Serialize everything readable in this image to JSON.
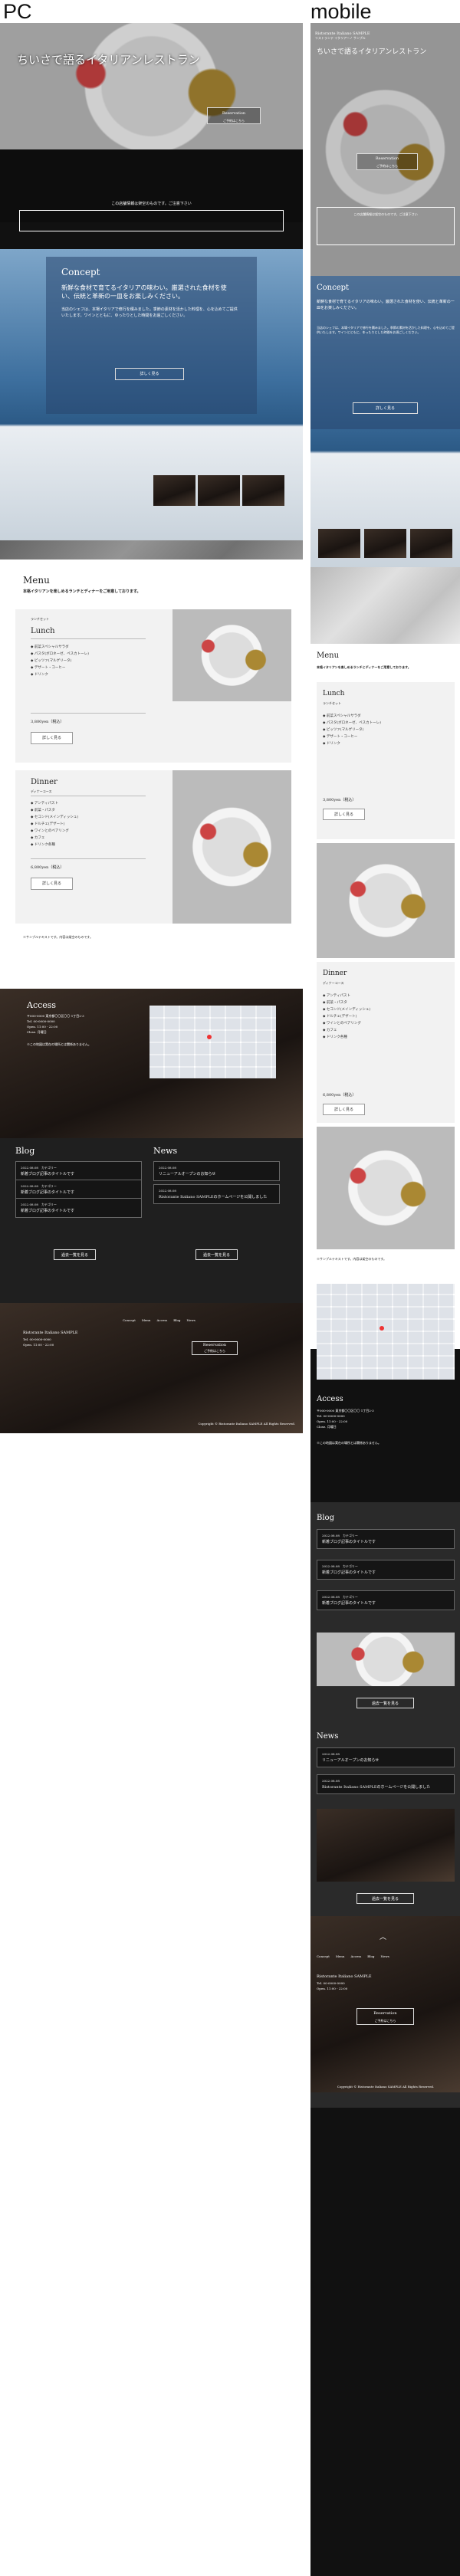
{
  "headers": {
    "pc": "PC",
    "mobile": "mobile"
  },
  "site": {
    "logo_en": "Ristorante Italiano SAMPLE",
    "logo_jp": "リストランテ イタリアーノ サンプル",
    "hero_title": "ちいさで語るイタリアンレストラン",
    "hero_title_mobile": "ちいさで語るイタリアンレストラン",
    "reservation": "Reservation",
    "reservation_sub": "ご予約はこちら",
    "notice": "この店舗情報は架空のものです。ご注意下さい"
  },
  "concept": {
    "title": "Concept",
    "lead": "新鮮な食材で育てるイタリアの味わい。厳選された食材を使い、伝統と革新の一皿をお楽しみください。",
    "body": "当店のシェフは、本場イタリアで修行を積みました。季節の素材を活かした料理を、心を込めてご提供いたします。ワインとともに、ゆったりとした時間をお過ごしください。",
    "button": "詳しく見る"
  },
  "menu": {
    "title": "Menu",
    "lead": "本格イタリアンを楽しめるランチとディナーをご用意しております。",
    "lunch": {
      "title": "Lunch",
      "sub": "ランチセット",
      "items": [
        "前菜スペシャルサラダ",
        "パスタ(ボロネーゼ、ペスカトーレ)",
        "ピッツァ(マルゲリータ)",
        "デザート・コーヒー",
        "ドリンク"
      ],
      "price": "3,800yen（税込）",
      "button": "詳しく見る"
    },
    "dinner": {
      "title": "Dinner",
      "sub": "ディナーコース",
      "items": [
        "アンティパスト",
        "前菜・パスタ",
        "セコンド(メインディッシュ)",
        "ドルチェ(デザート)",
        "ワインとのペアリング",
        "カフェ",
        "ドリンク各種"
      ],
      "price": "6,800yen（税込）",
      "button": "詳しく見る"
    },
    "note": "※サンプルテキストです。内容は架空のものです。"
  },
  "access": {
    "title": "Access",
    "address": "〒000-0000 東京都〇〇区〇〇 1丁目2-3",
    "tel": "Tel. 00-0000-0000",
    "hours": "Open. 11:00 - 22:00",
    "closed": "Close. 月曜日",
    "note": "※この地図は実在の場所とは関係ありません。"
  },
  "blog": {
    "title": "Blog",
    "entries": [
      {
        "date": "2022.08.08",
        "cat": "カテゴリー",
        "title": "新着ブログ記事のタイトルです"
      },
      {
        "date": "2022.08.08",
        "cat": "カテゴリー",
        "title": "新着ブログ記事のタイトルです"
      },
      {
        "date": "2022.08.08",
        "cat": "カテゴリー",
        "title": "新着ブログ記事のタイトルです"
      }
    ],
    "button": "過去一覧を見る"
  },
  "news": {
    "title": "News",
    "entries": [
      {
        "date": "2022.08.08",
        "title": "リニューアルオープンのお知らせ"
      },
      {
        "date": "2022.08.08",
        "title": "Ristorante Italiano SAMPLEのホームページを公開しました"
      }
    ],
    "button": "過去一覧を見る"
  },
  "footer": {
    "nav": [
      "Concept",
      "Menu",
      "Access",
      "Blog",
      "News"
    ],
    "name": "Ristorante Italiano SAMPLE",
    "tel": "Tel. 00-0000-0000",
    "hours": "Open. 11:00 - 22:00",
    "copyright": "Copyright © Ristorante Italiano SAMPLE All Rights Reserved."
  }
}
